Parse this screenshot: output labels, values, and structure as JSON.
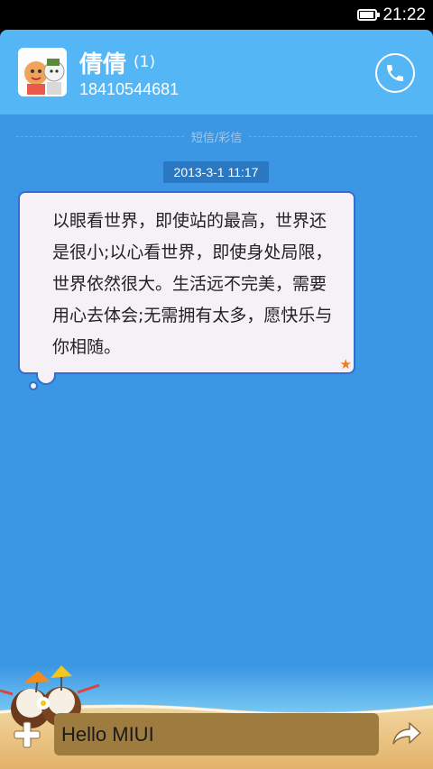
{
  "status_bar": {
    "time": "21:22",
    "battery_level": 0.9
  },
  "contact": {
    "name": "倩倩",
    "unread_count": "(1)",
    "phone": "18410544681"
  },
  "divider": {
    "label": "短信/彩信"
  },
  "message": {
    "timestamp": "2013-3-1 11:17",
    "text": "以眼看世界，即使站的最高，世界还是很小;以心看世界，即使身处局限，世界依然很大。生活远不完美，需要用心去体会;无需拥有太多，愿快乐与你相随。",
    "starred": true
  },
  "composer": {
    "input_value": "Hello MIUI"
  },
  "icons": {
    "call": "phone-icon",
    "add": "plus-icon",
    "send": "send-arrow-icon",
    "star": "star-icon"
  },
  "colors": {
    "background": "#3b96e4",
    "header": "#55b6f6",
    "bubble": "#f6f1f7",
    "bubble_border": "#2f6fd0",
    "timestamp_bg": "#2a77c2",
    "star": "#f27b1c",
    "input_bg": "#9e7b3f"
  }
}
